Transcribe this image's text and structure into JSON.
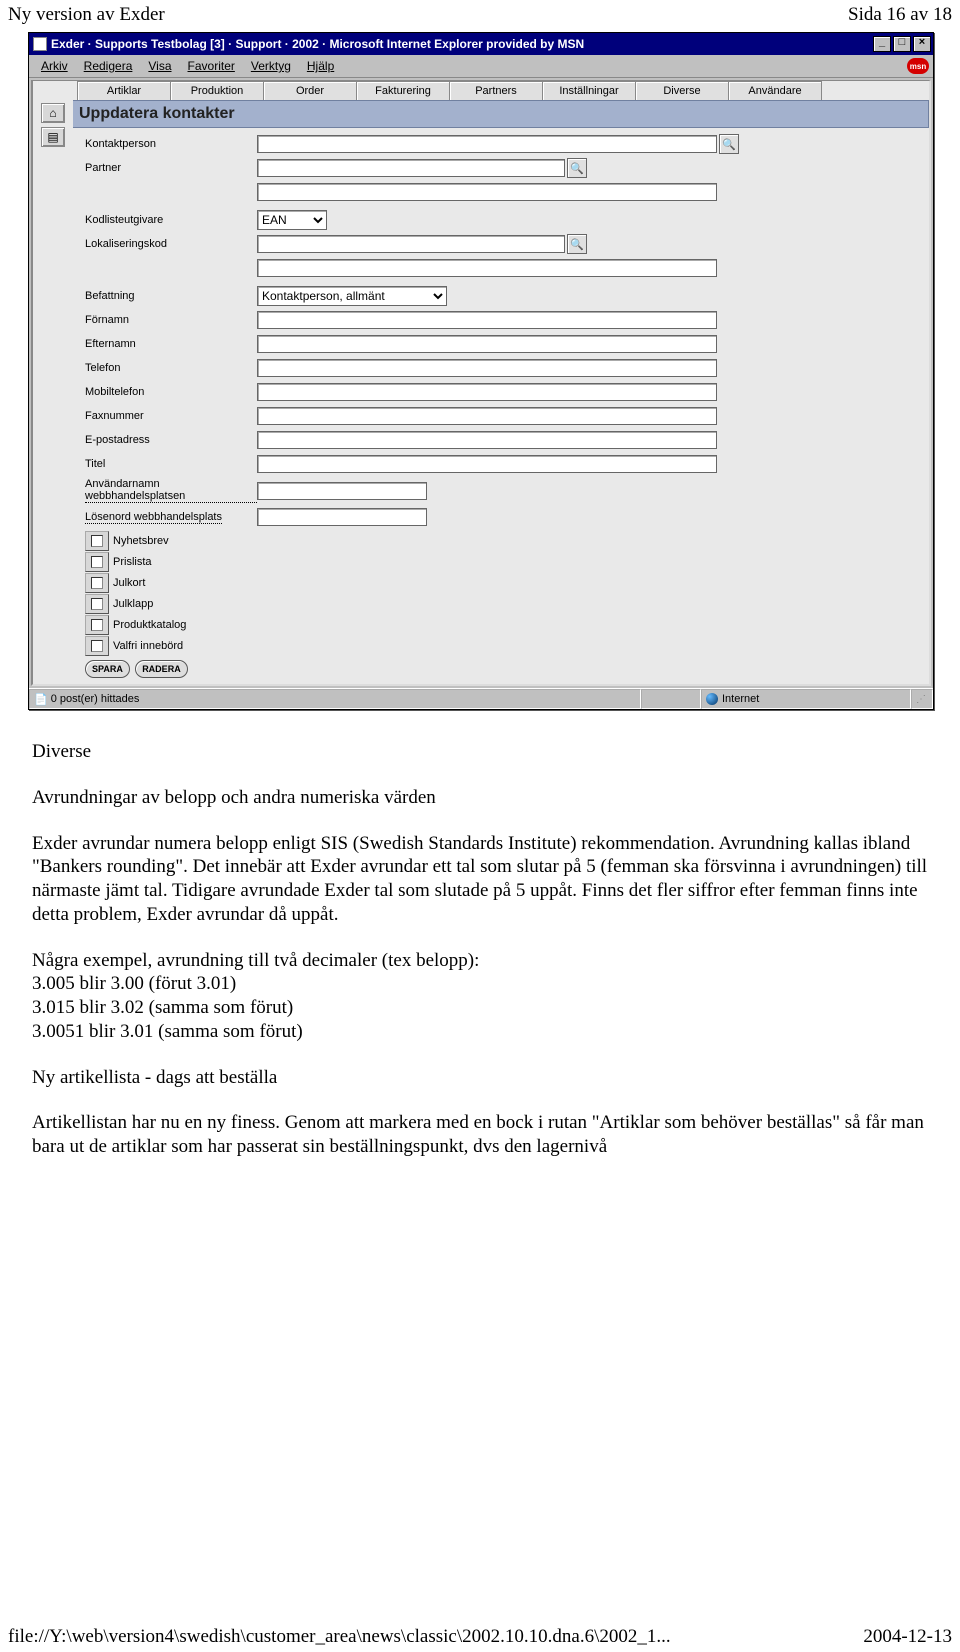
{
  "page_header": {
    "left": "Ny version av Exder",
    "right": "Sida 16 av 18"
  },
  "ie": {
    "title": "Exder · Supports Testbolag [3] · Support · 2002 · Microsoft Internet Explorer provided by MSN",
    "menu": [
      "Arkiv",
      "Redigera",
      "Visa",
      "Favoriter",
      "Verktyg",
      "Hjälp"
    ],
    "msn": "msn",
    "win_btns": {
      "min": "_",
      "max": "□",
      "close": "×"
    }
  },
  "tabs": [
    "Artiklar",
    "Produktion",
    "Order",
    "Fakturering",
    "Partners",
    "Inställningar",
    "Diverse",
    "Användare"
  ],
  "section_title": "Uppdatera kontakter",
  "gutter": {
    "home": "⌂",
    "list": "▤"
  },
  "form": {
    "kontaktperson": "Kontaktperson",
    "partner": "Partner",
    "kodlist": "Kodlisteutgivare",
    "kodlist_value": "EAN",
    "lokal": "Lokaliseringskod",
    "befattning": "Befattning",
    "befattning_value": "Kontaktperson, allmänt",
    "fornamn": "Förnamn",
    "efternamn": "Efternamn",
    "telefon": "Telefon",
    "mobil": "Mobiltelefon",
    "fax": "Faxnummer",
    "epost": "E-postadress",
    "titel": "Titel",
    "anv": "Användarnamn webbhandelsplatsen",
    "los": "Lösenord webbhandelsplats",
    "magnify": "🔍"
  },
  "checks": [
    "Nyhetsbrev",
    "Prislista",
    "Julkort",
    "Julklapp",
    "Produktkatalog",
    "Valfri innebörd"
  ],
  "actions": {
    "spara": "SPARA",
    "radera": "RADERA"
  },
  "status": {
    "left_icon": "📄",
    "left": "0 post(er) hittades",
    "right": "Internet",
    "grip": "⋰"
  },
  "body": {
    "h1": "Diverse",
    "h2": "Avrundningar av belopp och andra numeriska värden",
    "p1": "Exder avrundar numera belopp enligt SIS (Swedish Standards Institute) rekommendation. Avrundning kallas ibland \"Bankers rounding\". Det innebär att Exder avrundar ett tal som slutar på 5 (femman ska försvinna i avrundningen) till närmaste jämt tal. Tidigare avrundade Exder tal som slutade på 5 uppåt. Finns det fler siffror efter femman finns inte detta problem, Exder avrundar då uppåt.",
    "p2a": "Några exempel, avrundning till två decimaler (tex belopp):",
    "p2b": "3.005 blir 3.00 (förut 3.01)",
    "p2c": "3.015 blir 3.02 (samma som förut)",
    "p2d": "3.0051 blir 3.01 (samma som förut)",
    "h3": "Ny artikellista - dags att beställa",
    "p3": "Artikellistan har nu en ny finess. Genom att markera med en bock i rutan \"Artiklar som behöver beställas\" så får man bara ut de artiklar som har passerat sin beställningspunkt, dvs den lagernivå"
  },
  "footer": {
    "left": "file://Y:\\web\\version4\\swedish\\customer_area\\news\\classic\\2002.10.10.dna.6\\2002_1...",
    "right": "2004-12-13"
  }
}
